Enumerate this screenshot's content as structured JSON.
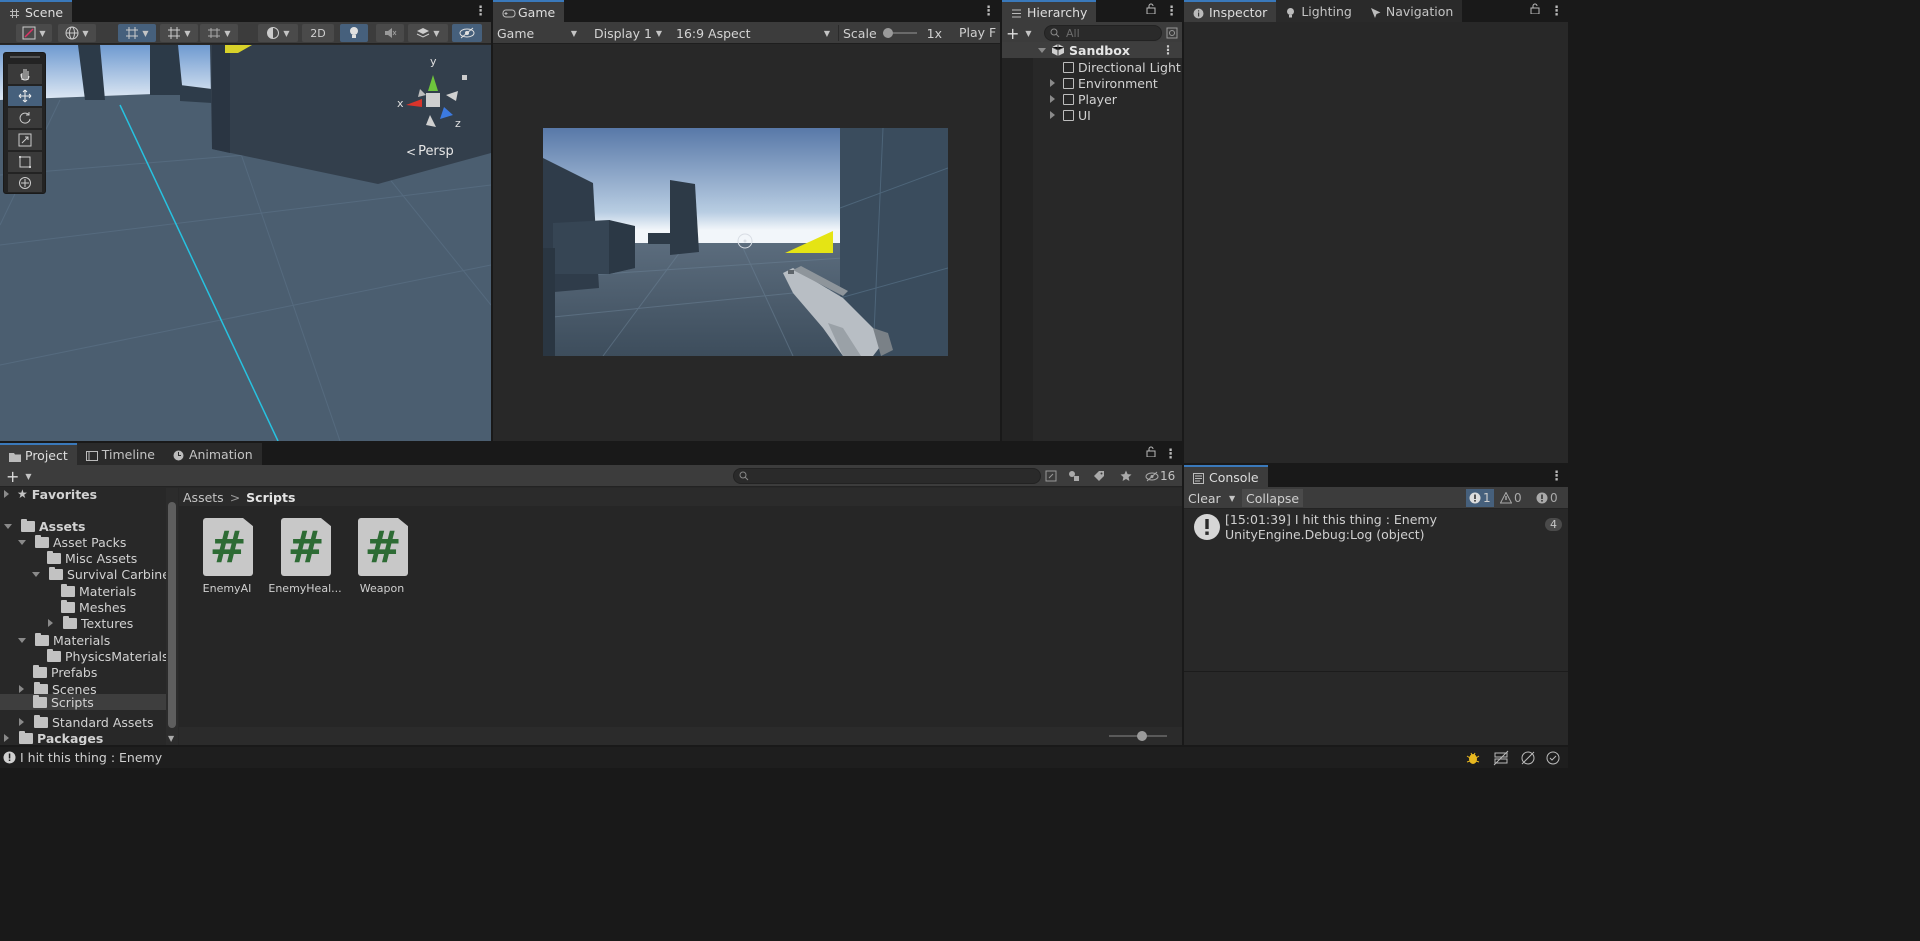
{
  "scene": {
    "tab_label": "Scene",
    "btn_2d": "2D",
    "gizmo_y": "y",
    "gizmo_x": "x",
    "gizmo_z": "z",
    "persp_label": "Persp"
  },
  "game": {
    "tab_label": "Game",
    "mode_dropdown": "Game",
    "display_dropdown": "Display 1",
    "aspect_dropdown": "16:9 Aspect",
    "scale_label": "Scale",
    "scale_value": "1x",
    "play_label": "Play F"
  },
  "hierarchy": {
    "tab_label": "Hierarchy",
    "search_placeholder": "All",
    "scene_name": "Sandbox",
    "items": [
      {
        "label": "Directional Light"
      },
      {
        "label": "Environment"
      },
      {
        "label": "Player"
      },
      {
        "label": "UI"
      }
    ]
  },
  "inspector": {
    "tabs": [
      {
        "label": "Inspector"
      },
      {
        "label": "Lighting"
      },
      {
        "label": "Navigation"
      }
    ]
  },
  "project": {
    "tabs": [
      {
        "label": "Project"
      },
      {
        "label": "Timeline"
      },
      {
        "label": "Animation"
      }
    ],
    "hidden_count": "16",
    "tree": [
      {
        "label": "Favorites"
      },
      {
        "label": "Assets"
      },
      {
        "label": "Asset Packs"
      },
      {
        "label": "Misc Assets"
      },
      {
        "label": "Survival Carbine"
      },
      {
        "label": "Materials"
      },
      {
        "label": "Meshes"
      },
      {
        "label": "Textures"
      },
      {
        "label": "Materials"
      },
      {
        "label": "PhysicsMaterials"
      },
      {
        "label": "Prefabs"
      },
      {
        "label": "Scenes"
      },
      {
        "label": "Scripts"
      },
      {
        "label": "Standard Assets"
      },
      {
        "label": "Packages"
      }
    ],
    "breadcrumb": {
      "root": "Assets",
      "separator": ">",
      "current": "Scripts"
    },
    "files": [
      {
        "label": "EnemyAI"
      },
      {
        "label": "EnemyHeal..."
      },
      {
        "label": "Weapon"
      }
    ]
  },
  "console": {
    "tab_label": "Console",
    "clear_label": "Clear",
    "collapse_label": "Collapse",
    "errors_count": "1",
    "warnings_count": "0",
    "messages_count": "0",
    "entry_line1": "[15:01:39] I hit this thing : Enemy",
    "entry_line2": "UnityEngine.Debug:Log (object)",
    "entry_count": "4"
  },
  "statusbar": {
    "message": "I hit this thing : Enemy"
  },
  "colors": {
    "accent": "#3a79bb",
    "panel": "#282828",
    "toolbar": "#3c3c3c",
    "script_green": "#2d6b34",
    "selection": "#46607c",
    "crosshair_yellow": "#e5e414"
  }
}
